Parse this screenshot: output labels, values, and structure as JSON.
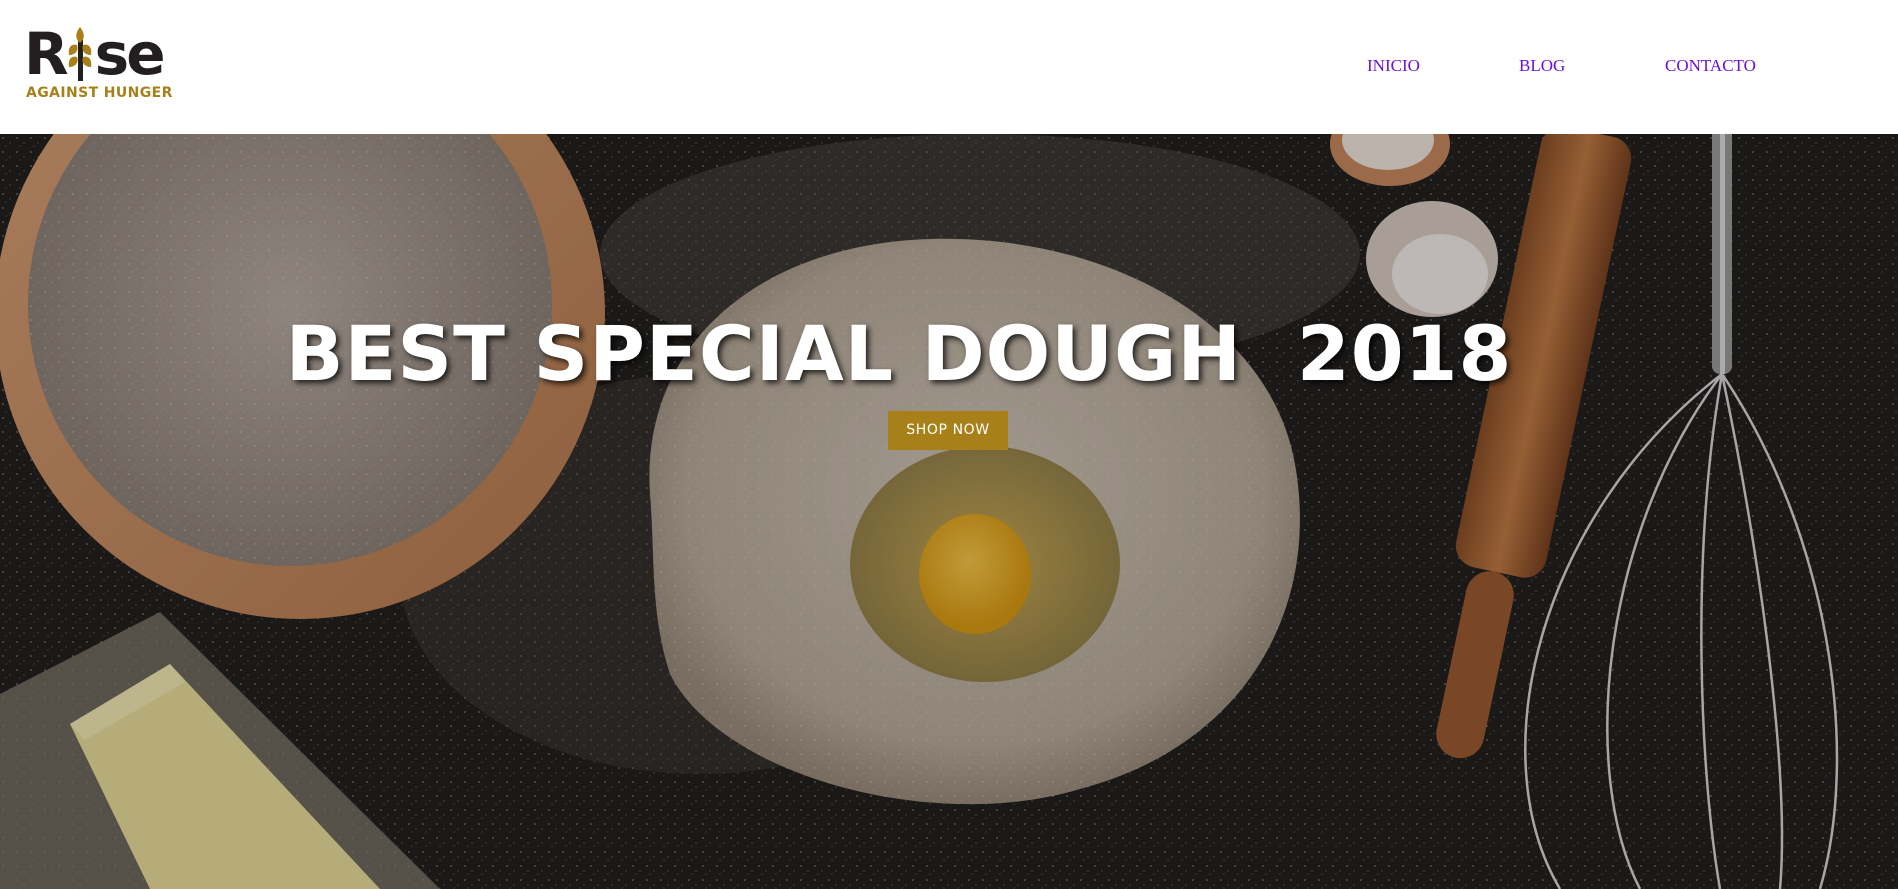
{
  "brand": {
    "logo_main_left": "R",
    "logo_main_right": "se",
    "logo_tagline": "AGAINST HUNGER",
    "brand_dark": "#231f20",
    "brand_gold": "#a7801a"
  },
  "nav": {
    "items": [
      {
        "label": "INICIO"
      },
      {
        "label": "BLOG"
      },
      {
        "label": "CONTACTO"
      }
    ],
    "link_color": "#6a11d8"
  },
  "hero": {
    "title": "BEST SPECIAL DOUGH  2018",
    "cta_label": "SHOP NOW",
    "cta_color": "#a7801a",
    "image_subject": "baking-ingredients-photo"
  }
}
